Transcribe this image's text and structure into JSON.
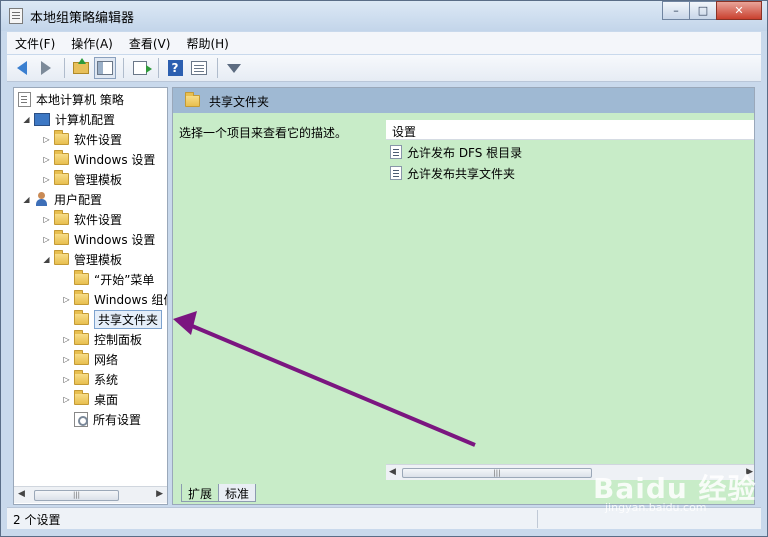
{
  "window": {
    "title": "本地组策略编辑器",
    "controls": {
      "minimize": "–",
      "maximize": "□",
      "close": "✕"
    }
  },
  "menubar": {
    "items": [
      "文件(F)",
      "操作(A)",
      "查看(V)",
      "帮助(H)"
    ]
  },
  "toolbar": {
    "icons": [
      "back-icon",
      "forward-icon",
      "up-folder-icon",
      "show-hide-tree-icon",
      "export-list-icon",
      "help-icon",
      "view-icon",
      "filter-icon"
    ]
  },
  "tree": {
    "root": "本地计算机 策略",
    "computer_config": "计算机配置",
    "cc_software": "软件设置",
    "cc_windows": "Windows 设置",
    "cc_admin": "管理模板",
    "user_config": "用户配置",
    "uc_software": "软件设置",
    "uc_windows": "Windows 设置",
    "uc_admin": "管理模板",
    "start_menu": "“开始”菜单",
    "windows_components": "Windows 组件",
    "shared_folders": "共享文件夹",
    "control_panel": "控制面板",
    "network": "网络",
    "system": "系统",
    "desktop": "桌面",
    "all_settings": "所有设置"
  },
  "details": {
    "header": "共享文件夹",
    "description": "选择一个项目来查看它的描述。",
    "column_header": "设置",
    "rows": [
      "允许发布 DFS 根目录",
      "允许发布共享文件夹"
    ],
    "tabs": [
      "扩展",
      "标准"
    ]
  },
  "statusbar": {
    "text": "2 个设置"
  },
  "watermark": {
    "logo": "Baidu 经验",
    "url": "jingyan.baidu.com"
  },
  "colors": {
    "detail_background": "#c8ecc8",
    "header_background": "#9fb9d3",
    "annotation_arrow": "#7b1680"
  }
}
